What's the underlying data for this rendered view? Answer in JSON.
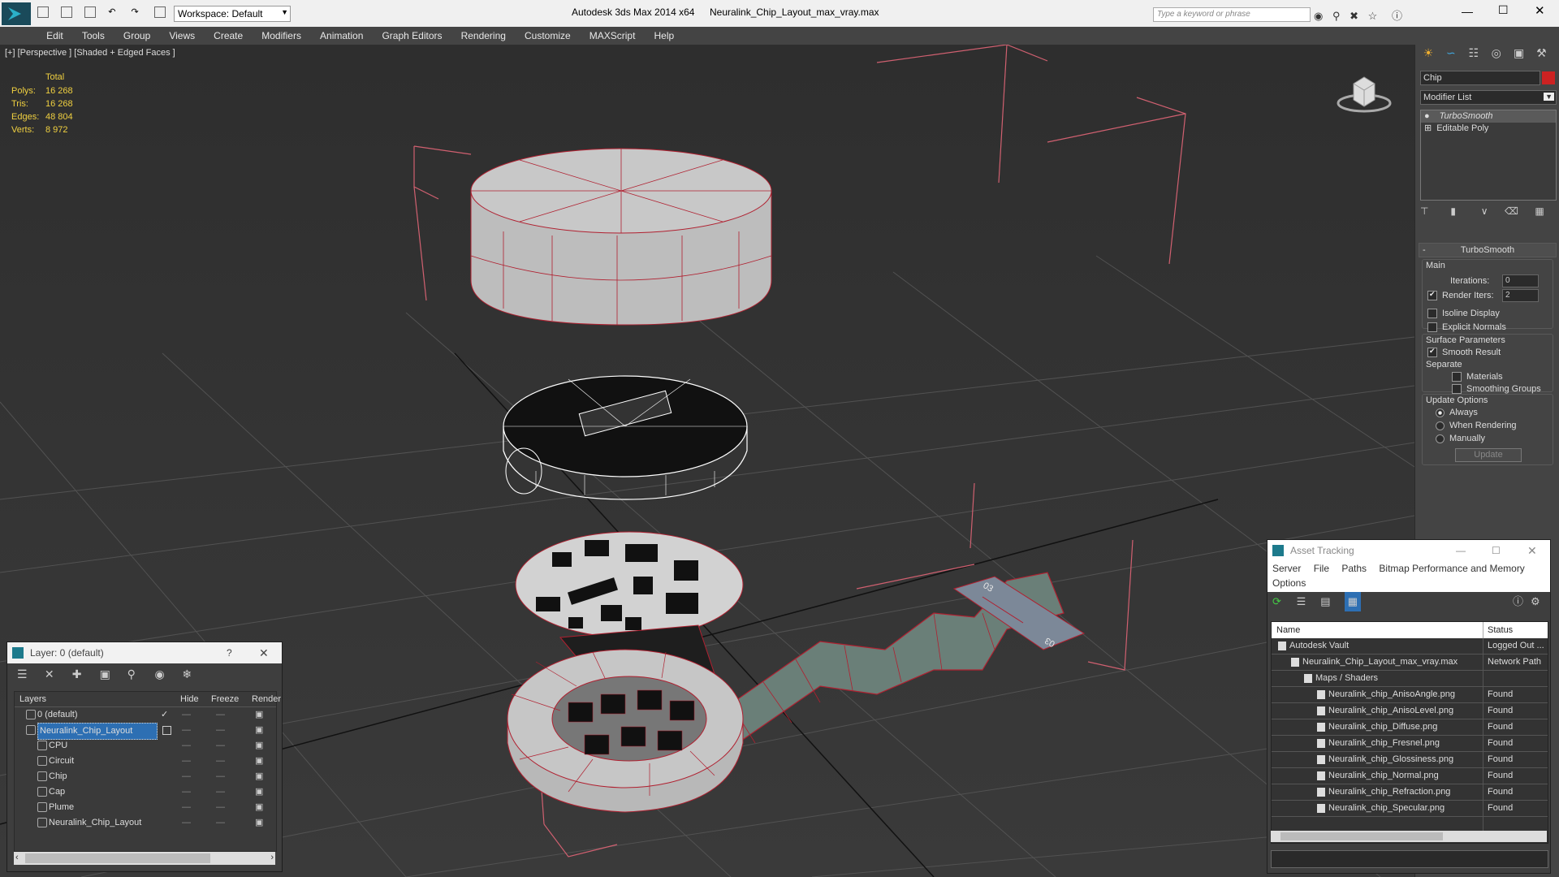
{
  "window": {
    "app_title": "Autodesk 3ds Max  2014 x64",
    "file_title": "Neuralink_Chip_Layout_max_vray.max",
    "workspace": "Workspace: Default",
    "search_placeholder": "Type a keyword or phrase"
  },
  "menu": [
    "Edit",
    "Tools",
    "Group",
    "Views",
    "Create",
    "Modifiers",
    "Animation",
    "Graph Editors",
    "Rendering",
    "Customize",
    "MAXScript",
    "Help"
  ],
  "viewport": {
    "label": "[+] [Perspective ] [Shaded + Edged Faces ]",
    "stats": {
      "total_label": "Total",
      "rows": [
        {
          "label": "Polys:",
          "value": "16 268"
        },
        {
          "label": "Tris:",
          "value": "16 268"
        },
        {
          "label": "Edges:",
          "value": "48 804"
        },
        {
          "label": "Verts:",
          "value": "8 972"
        }
      ]
    }
  },
  "command_panel": {
    "object_name": "Chip",
    "object_color": "#cc2222",
    "modifier_list": "Modifier List",
    "stack": [
      "TurboSmooth",
      "Editable Poly"
    ],
    "rollout_title": "TurboSmooth",
    "main_label": "Main",
    "iterations_label": "Iterations:",
    "iterations_value": "0",
    "render_iters_label": "Render Iters:",
    "render_iters_value": "2",
    "isoline": "Isoline Display",
    "explicit_normals": "Explicit Normals",
    "surface_params": "Surface Parameters",
    "smooth_result": "Smooth Result",
    "separate": "Separate",
    "materials": "Materials",
    "smoothing_groups": "Smoothing Groups",
    "update_options": "Update Options",
    "always": "Always",
    "when_rendering": "When Rendering",
    "manually": "Manually",
    "update_button": "Update"
  },
  "layer_window": {
    "title": "Layer: 0 (default)",
    "help": "?",
    "columns": [
      "Layers",
      "Hide",
      "Freeze",
      "Render"
    ],
    "layers": [
      {
        "name": "0 (default)",
        "indent": 1
      },
      {
        "name": "Neuralink_Chip_Layout",
        "indent": 1
      },
      {
        "name": "CPU",
        "indent": 2
      },
      {
        "name": "Circuit",
        "indent": 2
      },
      {
        "name": "Chip",
        "indent": 2
      },
      {
        "name": "Cap",
        "indent": 2
      },
      {
        "name": "Plume",
        "indent": 2
      },
      {
        "name": "Neuralink_Chip_Layout",
        "indent": 2
      }
    ]
  },
  "asset_window": {
    "title": "Asset Tracking",
    "menu": [
      "Server",
      "File",
      "Paths",
      "Bitmap Performance and Memory"
    ],
    "menu2": "Options",
    "columns": [
      "Name",
      "Status"
    ],
    "rows": [
      {
        "name": "Autodesk Vault",
        "status": "Logged Out ...",
        "indent": 0
      },
      {
        "name": "Neuralink_Chip_Layout_max_vray.max",
        "status": "Network Path",
        "indent": 1
      },
      {
        "name": "Maps / Shaders",
        "status": "",
        "indent": 2
      },
      {
        "name": "Neuralink_chip_AnisoAngle.png",
        "status": "Found",
        "indent": 3
      },
      {
        "name": "Neuralink_chip_AnisoLevel.png",
        "status": "Found",
        "indent": 3
      },
      {
        "name": "Neuralink_chip_Diffuse.png",
        "status": "Found",
        "indent": 3
      },
      {
        "name": "Neuralink_chip_Fresnel.png",
        "status": "Found",
        "indent": 3
      },
      {
        "name": "Neuralink_chip_Glossiness.png",
        "status": "Found",
        "indent": 3
      },
      {
        "name": "Neuralink_chip_Normal.png",
        "status": "Found",
        "indent": 3
      },
      {
        "name": "Neuralink_chip_Refraction.png",
        "status": "Found",
        "indent": 3
      },
      {
        "name": "Neuralink_chip_Specular.png",
        "status": "Found",
        "indent": 3
      }
    ]
  }
}
